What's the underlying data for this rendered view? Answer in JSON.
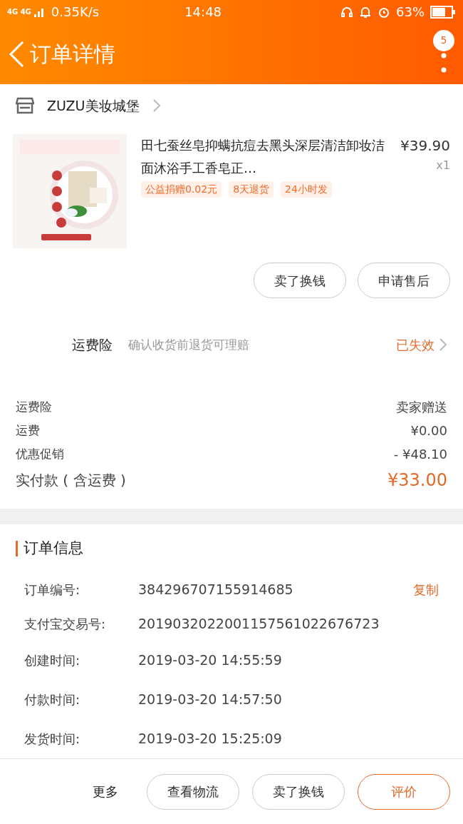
{
  "status_bar": {
    "network": "4G 4G",
    "speed": "0.35K/s",
    "time": "14:48",
    "battery": "63%"
  },
  "header": {
    "title": "订单详情",
    "badge": "5"
  },
  "shop": {
    "name": "ZUZU美妆城堡"
  },
  "product": {
    "title": "田七蚕丝皂抑螨抗痘去黑头深层清洁卸妆洁面沐浴手工香皂正…",
    "price": "¥39.90",
    "quantity": "x1",
    "tags": [
      "公益捐赠0.02元",
      "8天退货",
      "24小时发"
    ]
  },
  "product_actions": [
    "卖了换钱",
    "申请售后"
  ],
  "insurance": {
    "label": "运费险",
    "description": "确认收货前退货可理赔",
    "status": "已失效"
  },
  "summary": [
    {
      "label": "运费险",
      "value": "卖家赠送",
      "kind": "normal"
    },
    {
      "label": "运费",
      "value": "¥0.00",
      "kind": "normal"
    },
    {
      "label": "优惠促销",
      "value": "- ¥48.10",
      "kind": "normal"
    },
    {
      "label": "实付款 ( 含运费 )",
      "value": "¥33.00",
      "kind": "total"
    }
  ],
  "order_info": {
    "title": "订单信息",
    "copy": "复制",
    "rows": [
      {
        "label": "订单编号:",
        "value": "384296707155914685"
      },
      {
        "label": "支付宝交易号:",
        "value": "2019032022001157561022676723"
      },
      {
        "label": "创建时间:",
        "value": "2019-03-20 14:55:59"
      },
      {
        "label": "付款时间:",
        "value": "2019-03-20 14:57:50"
      },
      {
        "label": "发货时间:",
        "value": "2019-03-20 15:25:09"
      }
    ]
  },
  "bottom_bar": {
    "more": "更多",
    "buttons": [
      {
        "label": "查看物流",
        "primary": false
      },
      {
        "label": "卖了换钱",
        "primary": false
      },
      {
        "label": "评价",
        "primary": true
      }
    ]
  }
}
